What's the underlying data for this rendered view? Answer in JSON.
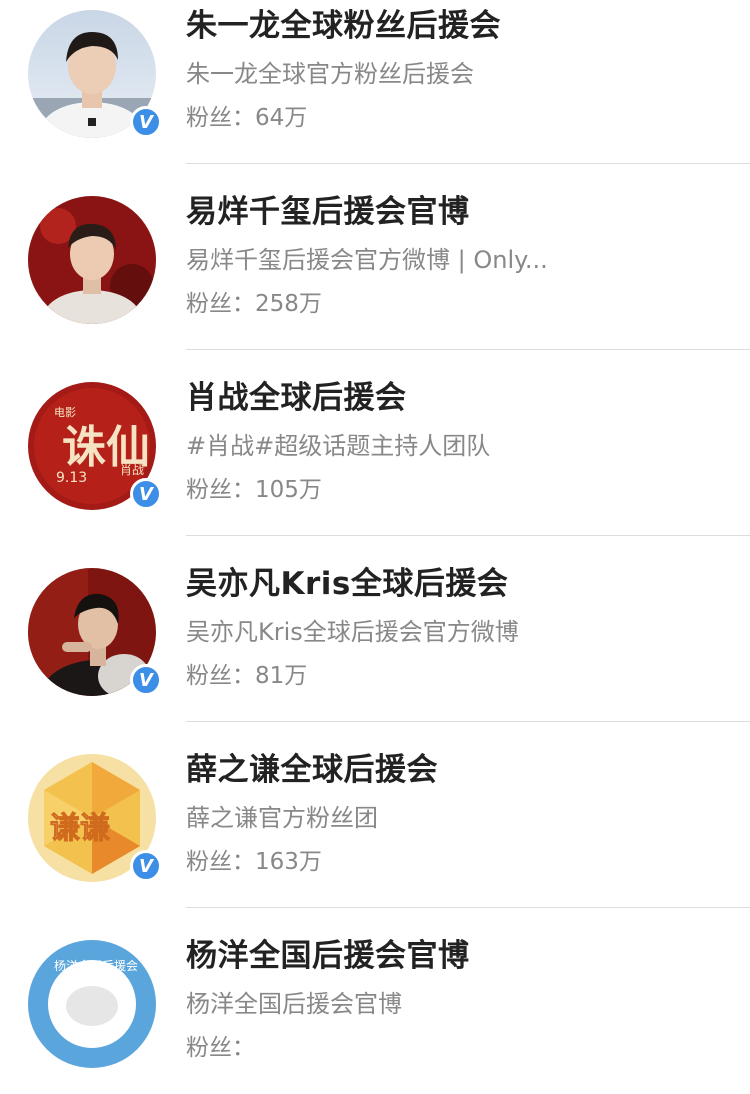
{
  "accounts": [
    {
      "name": "朱一龙全球粉丝后援会",
      "desc": "朱一龙全球官方粉丝后援会",
      "fans_label": "粉丝：",
      "fans_count": "64万",
      "verified": true,
      "verified_glyph": "V"
    },
    {
      "name": "易烊千玺后援会官博",
      "desc": "易烊千玺后援会官方微博 | Only...",
      "fans_label": "粉丝：",
      "fans_count": "258万",
      "verified": false
    },
    {
      "name": "肖战全球后援会",
      "desc": "#肖战#超级话题主持人团队",
      "fans_label": "粉丝：",
      "fans_count": "105万",
      "verified": true,
      "verified_glyph": "V",
      "avatar_text": {
        "top": "电影",
        "main": "诛仙",
        "date": "9.13",
        "side": "肖战"
      }
    },
    {
      "name": "吴亦凡Kris全球后援会",
      "desc": "吴亦凡Kris全球后援会官方微博",
      "fans_label": "粉丝：",
      "fans_count": "81万",
      "verified": true,
      "verified_glyph": "V"
    },
    {
      "name": "薛之谦全球后援会",
      "desc": "薛之谦官方粉丝团",
      "fans_label": "粉丝：",
      "fans_count": "163万",
      "verified": true,
      "verified_glyph": "V",
      "avatar_text": {
        "main": "谦谦"
      }
    },
    {
      "name": "杨洋全国后援会官博",
      "desc": "杨洋全国后援会官博",
      "fans_label": "粉丝：",
      "fans_count": "",
      "verified": false,
      "avatar_text": {
        "arc": "杨洋全国后援会"
      }
    }
  ],
  "colors": {
    "name": "#222222",
    "secondary": "#888888",
    "divider": "#dddddd",
    "verified_badge": "#3d8ee6"
  }
}
